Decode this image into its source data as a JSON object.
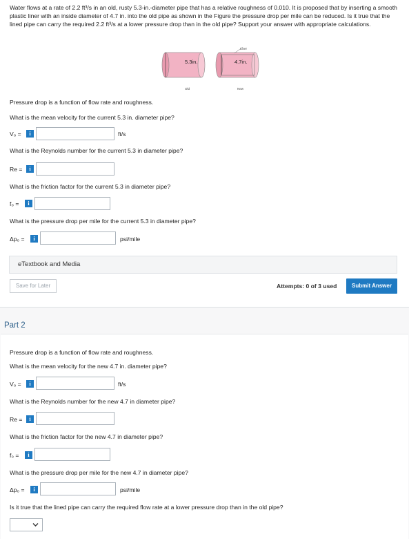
{
  "problem": {
    "text": "Water flows at a rate of 2.2 ft³/s in an old, rusty 5.3-in.-diameter pipe that has a relative roughness of 0.010. It is proposed that by inserting a smooth plastic liner with an inside diameter of 4.7 in. into the old pipe as shown in the Figure the pressure drop per mile can be reduced. Is it true that the lined pipe can carry the required 2.2 ft³/s at a lower pressure drop than in the old pipe? Support your answer with appropriate calculations."
  },
  "figure": {
    "old_dia": "5.3in.",
    "new_dia": "4.7in.",
    "old_caption": "Old",
    "new_caption": "New",
    "liner_label": "Liner",
    "pipe_color": "#f2b3c4"
  },
  "part1": {
    "intro": "Pressure drop is a function of flow rate and roughness.",
    "q_velocity": "What is the mean velocity for the current 5.3 in. diameter pipe?",
    "v_label": "V₀ =",
    "v_unit": "ft/s",
    "q_reynolds": "What is the Reynolds number for the current 5.3 in diameter pipe?",
    "re_label": "Re =",
    "q_friction": "What is the friction factor for the current 5.3 in diameter pipe?",
    "f_label": "f₀ =",
    "q_pressure": "What is the pressure drop per mile for the current 5.3 in diameter pipe?",
    "p_label": "Δp₀ =",
    "p_unit": "psi/mile",
    "info_glyph": "i"
  },
  "footer": {
    "ebook": "eTextbook and Media",
    "save": "Save for Later",
    "attempts": "Attempts: 0 of 3 used",
    "submit": "Submit Answer"
  },
  "part2": {
    "title": "Part 2",
    "intro": "Pressure drop is a function of flow rate and roughness.",
    "q_velocity": "What is the mean velocity for the new 4.7 in. diameter pipe?",
    "v_label": "V₀ =",
    "v_unit": "ft/s",
    "q_reynolds": "What is the Reynolds number for the new 4.7 in diameter pipe?",
    "re_label": "Re =",
    "q_friction": "What is the friction factor for the new 4.7 in diameter pipe?",
    "f_label": "f₀ =",
    "q_pressure": "What is the pressure drop per mile for the new 4.7 in diameter pipe?",
    "p_label": "Δp₀ =",
    "p_unit": "psi/mile",
    "q_final": "Is it true that the lined pipe can carry the required flow rate at a lower pressure drop than in the old pipe?",
    "info_glyph": "i"
  }
}
